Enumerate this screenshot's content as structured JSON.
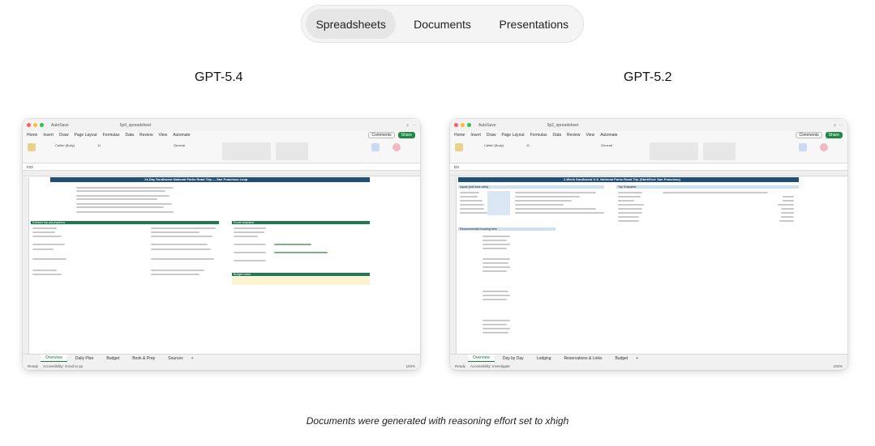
{
  "tabs": [
    {
      "label": "Spreadsheets",
      "active": true
    },
    {
      "label": "Documents",
      "active": false
    },
    {
      "label": "Presentations",
      "active": false
    }
  ],
  "left": {
    "model": "GPT-5.4",
    "window_title": "5p4_spreadsheet",
    "autosave": "AutoSave",
    "menu": [
      "Home",
      "Insert",
      "Draw",
      "Page Layout",
      "Formulas",
      "Data",
      "Review",
      "View",
      "Automate"
    ],
    "comments": "Comments",
    "share": "Share",
    "font": "Calibri (Body)",
    "font_size": "11",
    "number_format": "General",
    "cell_ref": "F22",
    "sheet_title": "14-Day Southwest National Parks Road Trip — San Francisco Loop",
    "section1": "Editable trip assumptions",
    "section2": "Route snapshot",
    "section3": "Budget notes",
    "sheet_tabs": [
      "Overview",
      "Daily Plan",
      "Budget",
      "Book & Prep",
      "Sources"
    ],
    "status": "Ready",
    "accessibility": "Accessibility: Good to go",
    "zoom": "100%"
  },
  "right": {
    "model": "GPT-5.2",
    "window_title": "5p2_spreadsheet",
    "autosave": "AutoSave",
    "menu": [
      "Home",
      "Insert",
      "Draw",
      "Page Layout",
      "Formulas",
      "Data",
      "Review",
      "View",
      "Automate"
    ],
    "comments": "Comments",
    "share": "Share",
    "font": "Calibri (Body)",
    "font_size": "11",
    "number_format": "General",
    "cell_ref": "D3",
    "sheet_title": "2-Week Southwest U.S. National Parks Road Trip (Start/End: San Francisco)",
    "section1": "Inputs (edit blue cells)",
    "section2": "Trip Snapshot",
    "section3": "Recommended booking tiers",
    "sheet_tabs": [
      "Overview",
      "Day by Day",
      "Lodging",
      "Reservations & Links",
      "Budget"
    ],
    "status": "Ready",
    "accessibility": "Accessibility: Investigate",
    "zoom": "100%"
  },
  "caption": "Documents were generated with reasoning effort set to xhigh",
  "colors": {
    "accent_green": "#1f8a44",
    "title_band": "#1f4e79",
    "section_green": "#1f7a50"
  }
}
